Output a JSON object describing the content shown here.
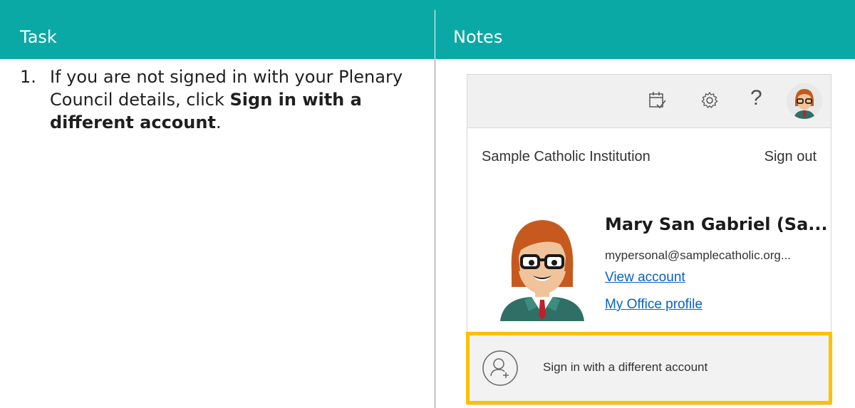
{
  "table": {
    "header": {
      "task": "Task",
      "notes": "Notes"
    },
    "step": {
      "number": "1.",
      "text_before": "If you are not signed in with your Plenary Council details, click ",
      "bold": "Sign in with a different account",
      "text_after": "."
    }
  },
  "account_panel": {
    "toolbar": {
      "icons": [
        "calendar-check-icon",
        "settings-gear-icon",
        "help-question-icon",
        "user-avatar"
      ],
      "help_glyph": "?"
    },
    "organization": "Sample Catholic Institution",
    "sign_out": "Sign out",
    "user_name": "Mary San Gabriel  (Sa...",
    "user_email": "mypersonal@samplecatholic.org...",
    "view_account": "View account",
    "office_profile": "My Office profile",
    "sign_in_different": "Sign in with a different account"
  },
  "colors": {
    "header_bg": "#0aa9a6",
    "highlight": "#ffc000",
    "link": "#0563c1"
  }
}
